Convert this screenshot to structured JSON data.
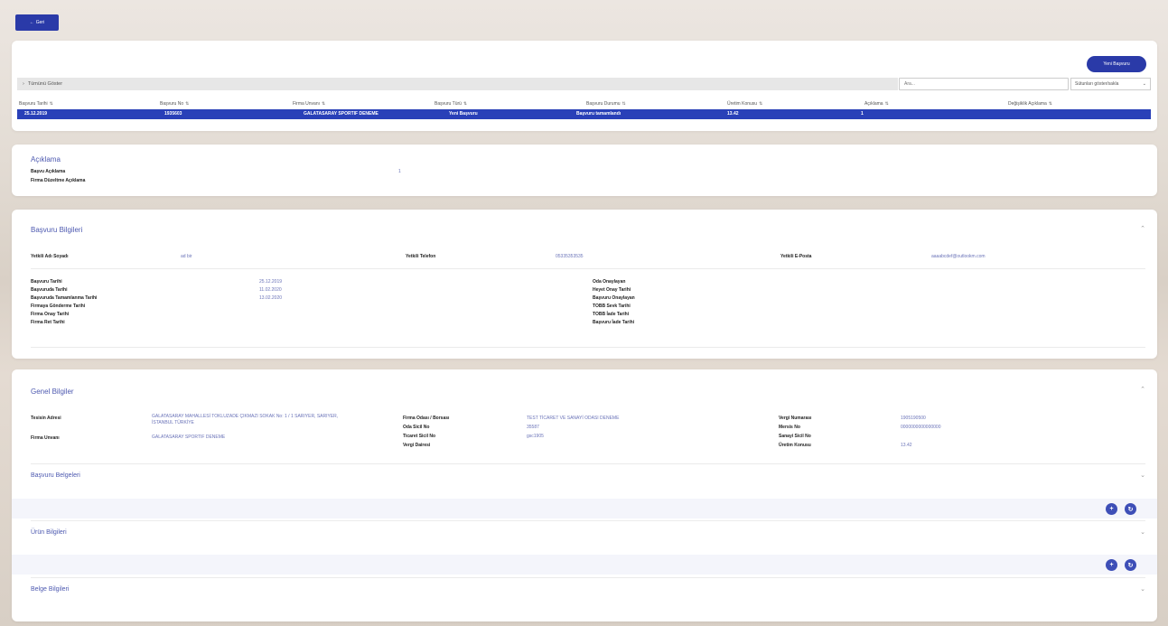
{
  "back_button": {
    "icon": "arrow-left-icon",
    "label": "Geri"
  },
  "list": {
    "new_button": "Yeni Başvuru",
    "group_bar": {
      "label": "Tümünü Göster"
    },
    "search_placeholder": "Ara...",
    "filter_select": "Sütunları göster/sakla",
    "columns": [
      "Başvuru Tarihi",
      "Başvuru No",
      "Firma Unvanı",
      "Başvuru Türü",
      "Başvuru Durumu",
      "Üretim Konusu",
      "Açıklama",
      "Değişiklik Açıklama"
    ],
    "row": [
      "25.12.2019",
      "1935603",
      "GALATASARAY SPORTIF DENEME",
      "Yeni Başvuru",
      "Başvuru tamamlandı",
      "13.42",
      "1",
      ""
    ]
  },
  "aciklama": {
    "title": "Açıklama",
    "items": [
      {
        "label": "Başvu Açıklama",
        "value": "1"
      },
      {
        "label": "Firma Düzeltme Açıklama",
        "value": ""
      }
    ]
  },
  "basvuru": {
    "title": "Başvuru Bilgileri",
    "contact": [
      {
        "label": "Yetkili Adı Soyadı",
        "value": "ad bir"
      },
      {
        "label": "Yetkili Telefon",
        "value": "05335353535"
      },
      {
        "label": "Yetkili E-Posta",
        "value": "aaaabcdef@outlookm.com"
      }
    ],
    "left_dates": [
      {
        "label": "Başvuru Tarihi",
        "value": "25.12.2019"
      },
      {
        "label": "Başvuruda Tarihi",
        "value": "11.02.2020"
      },
      {
        "label": "Başvuruda Tamamlanma Tarihi",
        "value": "13.02.2020"
      },
      {
        "label": "Firmaya Gönderme Tarihi",
        "value": ""
      },
      {
        "label": "Firma Onay Tarihi",
        "value": ""
      },
      {
        "label": "Firma Ret Tarihi",
        "value": ""
      }
    ],
    "right_dates": [
      {
        "label": "Oda Onaylayan",
        "value": ""
      },
      {
        "label": "Heyet Onay Tarihi",
        "value": ""
      },
      {
        "label": "Başvuru Onaylayan",
        "value": ""
      },
      {
        "label": "TOBB Sevk Tarihi",
        "value": ""
      },
      {
        "label": "TOBB İade Tarihi",
        "value": ""
      },
      {
        "label": "Başvuru İade Tarihi",
        "value": ""
      }
    ]
  },
  "genel": {
    "title": "Genel Bilgiler",
    "col1": [
      {
        "label": "Tesisin Adresi",
        "value": "GALATASARAY MAHALLESİ TOKLUZADE ÇIKMAZI SOKAK No: 1 / 1 SARIYER, SARIYER, İSTANBUL TÜRKİYE"
      },
      {
        "label": "Firma Unvanı",
        "value": "GALATASARAY SPORTIF DENEME"
      }
    ],
    "col2": [
      {
        "label": "Firma Odası / Borsası",
        "value": "TEST TİCARET VE SANAYİ ODASI DENEME"
      },
      {
        "label": "Oda Sicil No",
        "value": "35587"
      },
      {
        "label": "Ticaret Sicil No",
        "value": "gsc1905"
      },
      {
        "label": "Vergi Dairesi",
        "value": ""
      }
    ],
    "col3": [
      {
        "label": "Vergi Numarası",
        "value": "1905190500"
      },
      {
        "label": "Mersis No",
        "value": "0000000000000000"
      },
      {
        "label": "Sanayi Sicil No",
        "value": ""
      },
      {
        "label": "Üretim Konusu",
        "value": "13.42"
      }
    ],
    "subsections": [
      {
        "title": "Başvuru Belgeleri"
      },
      {
        "title": "Ürün Bilgileri"
      },
      {
        "title": "Belge Bilgileri"
      }
    ],
    "add_icon": "plus-circle-icon",
    "refresh_icon": "refresh-circle-icon",
    "collapse_icon": "chevron-up-icon",
    "expand_icon": "chevron-down-icon"
  }
}
